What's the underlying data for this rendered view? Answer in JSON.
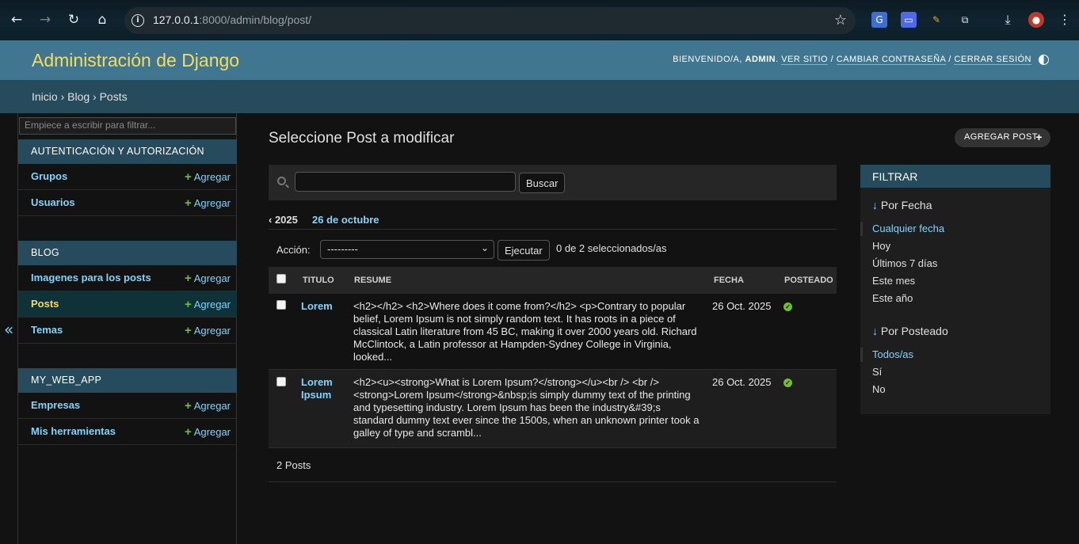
{
  "browser": {
    "url_host": "127.0.0.1",
    "url_rest": ":8000/admin/blog/post/"
  },
  "header": {
    "brand": "Administración de Django",
    "welcome": "BIENVENIDO/A, ",
    "user": "ADMIN",
    "view_site": "VER SITIO",
    "change_password": "CAMBIAR CONTRASEÑA",
    "logout": "CERRAR SESIÓN"
  },
  "breadcrumbs": "Inicio › Blog › Posts",
  "sidebar": {
    "filter_placeholder": "Empiece a escribir para filtrar...",
    "add_label": "Agregar",
    "modules": [
      {
        "caption": "AUTENTICACIÓN Y AUTORIZACIÓN",
        "models": [
          "Grupos",
          "Usuarios"
        ]
      },
      {
        "caption": "BLOG",
        "models": [
          "Imagenes para los posts",
          "Posts",
          "Temas"
        ]
      },
      {
        "caption": "MY_WEB_APP",
        "models": [
          "Empresas",
          "Mis herramientas"
        ]
      }
    ],
    "collapse_glyph": "«"
  },
  "content": {
    "title": "Seleccione Post a modificar",
    "add_button": "AGREGAR POST",
    "search_button": "Buscar",
    "date_hierarchy": {
      "year": "‹ 2025",
      "day": "26 de octubre"
    },
    "action_label": "Acción:",
    "action_select": "---------",
    "run_button": "Ejecutar",
    "selection_count": "0 de 2 seleccionados/as",
    "columns": [
      "TITULO",
      "RESUME",
      "FECHA",
      "POSTEADO"
    ],
    "rows": [
      {
        "title": "Lorem",
        "resume": "<h2></h2> <h2>Where does it come from?</h2> <p>Contrary to popular belief, Lorem Ipsum is not simply random text. It has roots in a piece of classical Latin literature from 45 BC, making it over 2000 years old. Richard McClintock, a Latin professor at Hampden-Sydney College in Virginia, looked...",
        "fecha": "26 Oct. 2025",
        "posted": true
      },
      {
        "title": "Lorem Ipsum",
        "resume": "<h2><u><strong>What is Lorem Ipsum?</strong></u><br /> <br /> <strong>Lorem Ipsum</strong>&nbsp;is simply dummy text of the printing and typesetting industry. Lorem Ipsum has been the industry&#39;s standard dummy text ever since the 1500s, when an unknown printer took a galley of type and scrambl...",
        "fecha": "26 Oct. 2025",
        "posted": true
      }
    ],
    "paginator": "2 Posts"
  },
  "filter": {
    "caption": "FILTRAR",
    "groups": [
      {
        "title": "Por Fecha",
        "options": [
          "Cualquier fecha",
          "Hoy",
          "Últimos 7 días",
          "Este mes",
          "Este año"
        ],
        "selected": 0
      },
      {
        "title": "Por Posteado",
        "options": [
          "Todos/as",
          "Sí",
          "No"
        ],
        "selected": 0
      }
    ]
  },
  "colors": {
    "header": "#417690",
    "brand": "#f5dd5d",
    "breadcrumbs": "#264b5d",
    "link": "#81d4fa",
    "add_plus": "#70bf2b"
  }
}
